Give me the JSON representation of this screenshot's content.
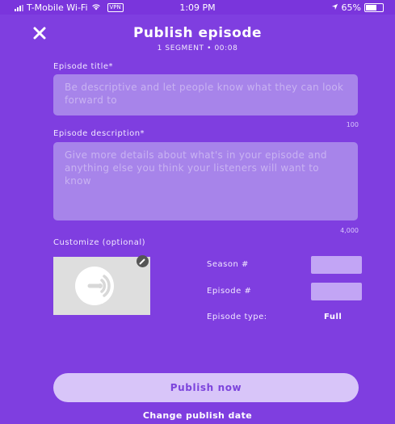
{
  "status_bar": {
    "carrier": "T-Mobile Wi-Fi",
    "vpn": "VPN",
    "time": "1:09 PM",
    "battery": "65%"
  },
  "header": {
    "close_icon": "close-icon",
    "title": "Publish episode",
    "subtitle": "1 SEGMENT • 00:08"
  },
  "episode_title": {
    "label": "Episode title*",
    "placeholder": "Be descriptive and let people know what they can look forward to",
    "counter": "100"
  },
  "episode_description": {
    "label": "Episode description*",
    "placeholder": "Give more details about what's in your episode and anything else you think your listeners will want to know",
    "counter": "4,000"
  },
  "customize": {
    "label": "Customize (optional)",
    "artwork_icon": "podcast-broadcast-icon",
    "edit_icon": "pencil-edit-icon",
    "season_label": "Season #",
    "episode_label": "Episode #",
    "type_label": "Episode type:",
    "type_value": "Full"
  },
  "actions": {
    "publish_now": "Publish now",
    "change_date": "Change publish date"
  },
  "colors": {
    "background": "#7f3ee0",
    "field": "#a784ea",
    "button": "#d8c5f9",
    "button_text": "#7c44dc"
  }
}
